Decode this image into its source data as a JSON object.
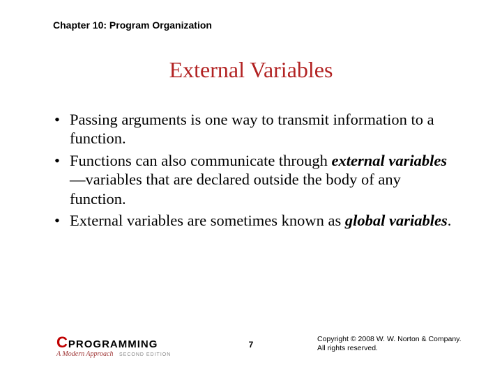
{
  "chapter_header": "Chapter 10: Program Organization",
  "title": "External Variables",
  "bullets": [
    {
      "pre": "Passing arguments is one way to transmit information to a function.",
      "em": "",
      "post": ""
    },
    {
      "pre": "Functions can also communicate through ",
      "em": "external variables",
      "post": "—variables that are declared outside the body of any function."
    },
    {
      "pre": "External variables are sometimes known as ",
      "em": "global variables",
      "post": "."
    }
  ],
  "logo": {
    "c": "C",
    "word": "PROGRAMMING",
    "sub": "A Modern Approach",
    "edition": "SECOND EDITION"
  },
  "page_num": "7",
  "copyright_line1": "Copyright © 2008 W. W. Norton & Company.",
  "copyright_line2": "All rights reserved."
}
